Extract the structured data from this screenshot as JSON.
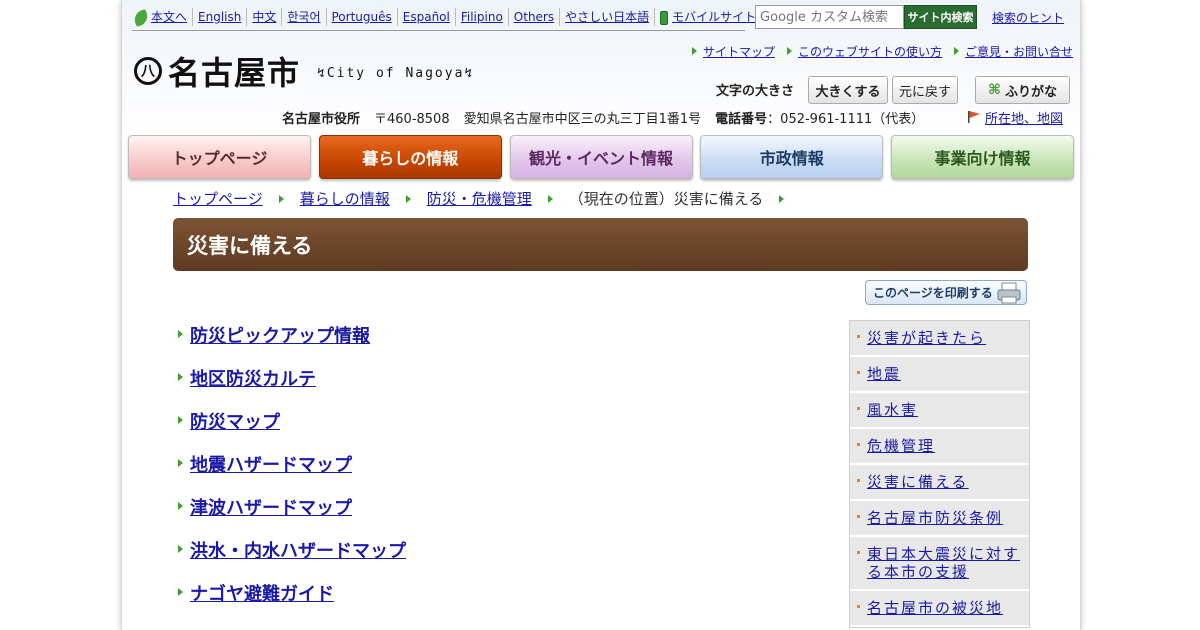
{
  "language_bar": {
    "items": [
      "本文へ",
      "English",
      "中文",
      "한국어",
      "Português",
      "Español",
      "Filipino",
      "Others",
      "やさしい日本語",
      "モバイルサイト"
    ]
  },
  "search": {
    "placeholder": "Google カスタム検索",
    "button": "サイト内検索",
    "hint": "検索のヒント"
  },
  "logo": {
    "mark": "八",
    "title": "名古屋市",
    "subtitle": "City of Nagoya"
  },
  "util_links": [
    "サイトマップ",
    "このウェブサイトの使い方",
    "ご意見・お問い合せ"
  ],
  "font_size": {
    "label": "文字の大きさ",
    "enlarge": "大きくする",
    "reset": "元に戻す"
  },
  "furigana": "ふりがな",
  "address": {
    "office": "名古屋市役所",
    "postal": "〒460-8508",
    "address": "愛知県名古屋市中区三の丸三丁目1番1号",
    "phone_label": "電話番号",
    "phone": "：052-961-1111（代表）",
    "map_link": "所在地、地図"
  },
  "nav": [
    "トップページ",
    "暮らしの情報",
    "観光・イベント情報",
    "市政情報",
    "事業向け情報"
  ],
  "breadcrumb": {
    "items": [
      "トップページ",
      "暮らしの情報",
      "防災・危機管理"
    ],
    "current": "（現在の位置）災害に備える"
  },
  "page_title": "災害に備える",
  "print_button": "このページを印刷する",
  "main_links": [
    "防災ピックアップ情報",
    "地区防災カルテ",
    "防災マップ",
    "地震ハザードマップ",
    "津波ハザードマップ",
    "洪水・内水ハザードマップ",
    "ナゴヤ避難ガイド"
  ],
  "side_menu": [
    "災害が起きたら",
    "地震",
    "風水害",
    "危機管理",
    "災害に備える",
    "名古屋市防災条例",
    "東日本大震災に対する本市の支援",
    "名古屋市の被災地"
  ],
  "colors": {
    "link": "#1a1aa6",
    "title_bar": "#6b4529",
    "nav_active": "#c74500",
    "search_button": "#2a6b30"
  }
}
